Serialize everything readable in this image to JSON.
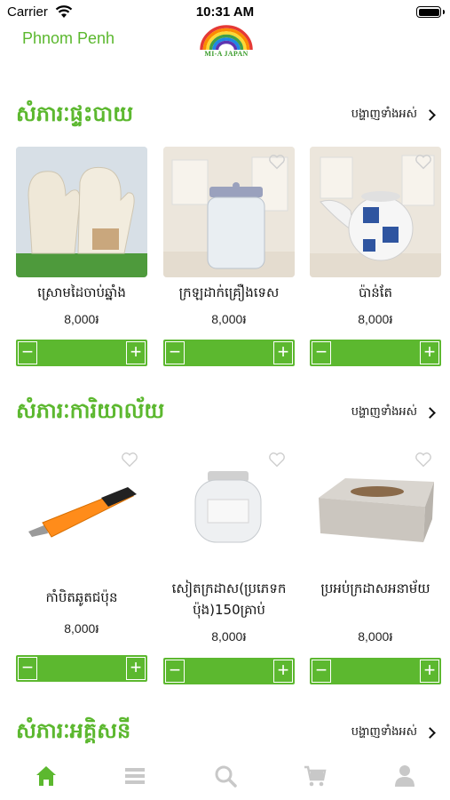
{
  "status": {
    "carrier": "Carrier",
    "time": "10:31 AM"
  },
  "header": {
    "location": "Phnom Penh",
    "logo_text": "MI-A JAPAN"
  },
  "sections": [
    {
      "title": "សំភារៈផ្ទះបាយ",
      "see_all": "បង្ហាញទាំងអស់",
      "products": [
        {
          "name": "ស្រោមដៃចាប់ឆ្នាំង",
          "price": "8,000៛"
        },
        {
          "name": "ក្រឡដាក់គ្រឿងទេស",
          "price": "8,000៛"
        },
        {
          "name": "ប៉ាន់តែ",
          "price": "8,000៛"
        }
      ]
    },
    {
      "title": "សំភារៈការិយាល័យ",
      "see_all": "បង្ហាញទាំងអស់",
      "products": [
        {
          "name": "កាំបិតឆូតជប៉ុន",
          "price": "8,000៛"
        },
        {
          "name": "សៀតក្រដាស(ប្រភេទកប៉ុង)150គ្រាប់",
          "price": "8,000៛"
        },
        {
          "name": "ប្រអប់ក្រដាសអនាម័យ",
          "price": "8,000៛"
        }
      ]
    },
    {
      "title": "សំភារៈអគ្គិសនី",
      "see_all": "បង្ហាញទាំងអស់"
    }
  ],
  "stepper": {
    "minus": "−",
    "plus": "+"
  },
  "tabs": [
    {
      "icon": "home-icon",
      "active": true
    },
    {
      "icon": "menu-icon",
      "active": false
    },
    {
      "icon": "search-icon",
      "active": false
    },
    {
      "icon": "cart-icon",
      "active": false
    },
    {
      "icon": "user-icon",
      "active": false
    }
  ],
  "colors": {
    "accent": "#5cb82f",
    "inactive": "#c8c8c8"
  }
}
